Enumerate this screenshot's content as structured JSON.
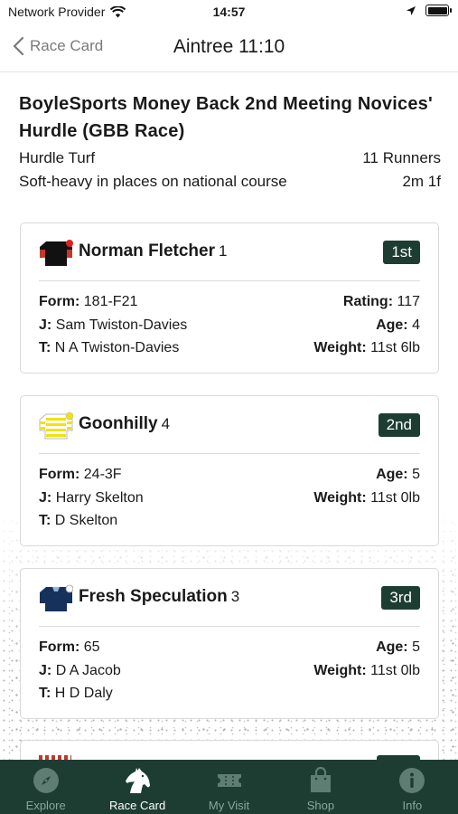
{
  "status": {
    "carrier": "Network Provider",
    "time": "14:57"
  },
  "nav": {
    "back_label": "Race Card",
    "title": "Aintree 11:10"
  },
  "race": {
    "title": "BoyleSports Money Back 2nd Meeting Novices' Hurdle (GBB Race)",
    "type": "Hurdle Turf",
    "runners": "11 Runners",
    "going": "Soft-heavy in places on national course",
    "distance": "2m 1f"
  },
  "labels": {
    "form": "Form:",
    "rating": "Rating:",
    "jockey": "J:",
    "age": "Age:",
    "trainer": "T:",
    "weight": "Weight:"
  },
  "runners": [
    {
      "name": "Norman Fletcher",
      "number": "1",
      "position": "1st",
      "form": "181-F21",
      "rating": "117",
      "jockey": "Sam Twiston-Davies",
      "age": "4",
      "trainer": "N A Twiston-Davies",
      "weight": "11st 6lb"
    },
    {
      "name": "Goonhilly",
      "number": "4",
      "position": "2nd",
      "form": "24-3F",
      "age": "5",
      "jockey": "Harry Skelton",
      "weight": "11st 0lb",
      "trainer": "D Skelton"
    },
    {
      "name": "Fresh Speculation",
      "number": "3",
      "position": "3rd",
      "form": "65",
      "age": "5",
      "jockey": "D A Jacob",
      "weight": "11st 0lb",
      "trainer": "H D Daly"
    }
  ],
  "tabs": [
    {
      "label": "Explore",
      "icon": "compass-icon"
    },
    {
      "label": "Race Card",
      "icon": "horse-head-icon",
      "active": true
    },
    {
      "label": "My Visit",
      "icon": "ticket-icon"
    },
    {
      "label": "Shop",
      "icon": "shopping-bag-icon"
    },
    {
      "label": "Info",
      "icon": "info-icon"
    }
  ],
  "colors": {
    "brand_green": "#1d3d33",
    "tab_inactive": "#8aa59c",
    "muted_text": "#7a7a7a"
  }
}
